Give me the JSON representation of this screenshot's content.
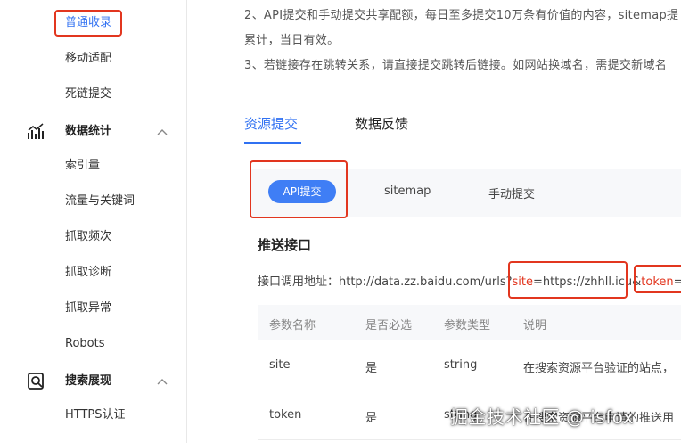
{
  "sidebar": {
    "items_top": [
      {
        "label": "普通收录",
        "highlighted": true
      },
      {
        "label": "移动适配"
      },
      {
        "label": "死链提交"
      }
    ],
    "group_stats": {
      "label": "数据统计",
      "icon": "bar-chart-icon",
      "expanded": true
    },
    "items_stats": [
      {
        "label": "索引量"
      },
      {
        "label": "流量与关键词"
      },
      {
        "label": "抓取频次"
      },
      {
        "label": "抓取诊断"
      },
      {
        "label": "抓取异常"
      },
      {
        "label": "Robots"
      }
    ],
    "group_search": {
      "label": "搜索展现",
      "icon": "search-doc-icon",
      "expanded": true
    },
    "items_search": [
      {
        "label": "HTTPS认证"
      }
    ]
  },
  "notice": {
    "line1": "2、API提交和手动提交共享配额，每日至多提交10万条有价值的内容，sitemap提",
    "line2": "累计，当日有效。",
    "line3": "3、若链接存在跳转关系，请直接提交跳转后链接。如网站换域名，需提交新域名"
  },
  "tabs": [
    {
      "label": "资源提交",
      "active": true
    },
    {
      "label": "数据反馈",
      "active": false
    }
  ],
  "subtabs": [
    {
      "label": "API提交",
      "active": true
    },
    {
      "label": "sitemap",
      "active": false
    },
    {
      "label": "手动提交",
      "active": false
    }
  ],
  "section": {
    "title": "推送接口",
    "url_prefix": "接口调用地址：http://data.zz.baidu.com/urls?",
    "site_key": "site",
    "site_value": "=https://zhhll.icu&",
    "token_key": "token",
    "token_value": "=ji"
  },
  "table": {
    "headers": [
      "参数名称",
      "是否必选",
      "参数类型",
      "说明"
    ],
    "rows": [
      {
        "name": "site",
        "required": "是",
        "type": "string",
        "desc": "在搜索资源平台验证的站点，"
      },
      {
        "name": "token",
        "required": "是",
        "type": "string",
        "desc": "在搜索资源平台申请的推送用"
      }
    ]
  },
  "watermark": "掘金技术社区 @ isfox",
  "colors": {
    "accent": "#3071f2",
    "highlight": "#e2361f",
    "pill": "#3f7ef5"
  }
}
